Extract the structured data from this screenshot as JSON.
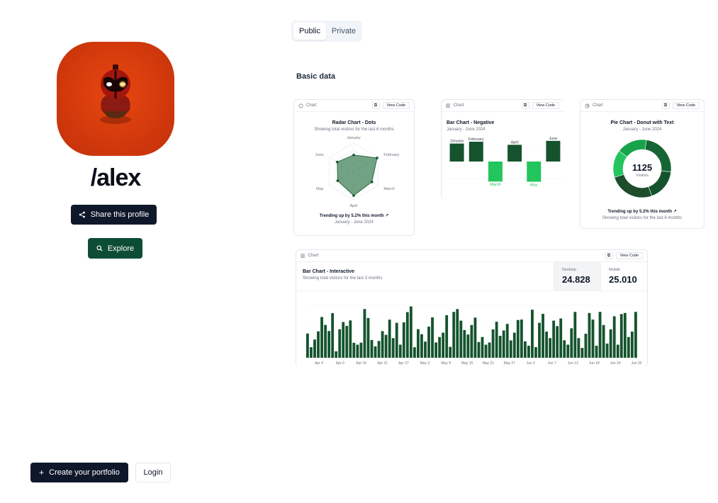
{
  "profile": {
    "username": "/alex",
    "share_label": "Share this profile",
    "explore_label": "Explore"
  },
  "footer": {
    "create_label": "Create your portfolio",
    "login_label": "Login"
  },
  "tabs": [
    {
      "label": "Public",
      "active": true
    },
    {
      "label": "Private",
      "active": false
    }
  ],
  "section_title": "Basic data",
  "card_common": {
    "chart_label": "Chart",
    "view_code_label": "View Code"
  },
  "colors": {
    "dark_green": "#14532d",
    "light_green": "#22c55e",
    "mid_green": "#166534",
    "navy": "#0f172a"
  },
  "chart_data": [
    {
      "type": "radar",
      "title": "Radar Chart - Dots",
      "subtitle": "Showing total visitors for the last 6 months",
      "categories": [
        "January",
        "February",
        "March",
        "April",
        "May",
        "June"
      ],
      "values": [
        186,
        305,
        237,
        273,
        209,
        214
      ],
      "footer_trend": "Trending up by 5.2% this month",
      "footer_range": "January - June 2024"
    },
    {
      "type": "bar",
      "title": "Bar Chart - Negative",
      "subtitle": "January - June 2024",
      "categories": [
        "January",
        "February",
        "March",
        "April",
        "May",
        "June"
      ],
      "values": [
        186,
        205,
        -207,
        173,
        -209,
        214
      ]
    },
    {
      "type": "pie",
      "title": "Pie Chart - Donut with Text",
      "subtitle": "January - June 2024",
      "center_value": "1125",
      "center_label": "Visitors",
      "values": [
        275,
        200,
        287,
        173,
        190
      ],
      "footer_trend": "Trending up by 5.2% this month",
      "footer_sub": "Showing total visitors for the last 6 months"
    },
    {
      "type": "bar",
      "title": "Bar Chart - Interactive",
      "subtitle": "Showing total visitors for the last 3 months",
      "stats": [
        {
          "label": "Desktop",
          "value": "24.828",
          "active": true
        },
        {
          "label": "Mobile",
          "value": "25.010",
          "active": false
        }
      ],
      "x_ticks": [
        "Apr 4",
        "Apr 9",
        "Apr 15",
        "Apr 21",
        "Apr 27",
        "May 3",
        "May 9",
        "May 15",
        "May 21",
        "May 27",
        "Jun 2",
        "Jun 7",
        "Jun 12",
        "Jun 18",
        "Jun 24",
        "Jun 30"
      ],
      "values": [
        222,
        97,
        167,
        242,
        373,
        301,
        245,
        409,
        59,
        261,
        327,
        292,
        342,
        137,
        120,
        138,
        446,
        364,
        163,
        105,
        154,
        244,
        210,
        349,
        180,
        320,
        120,
        324,
        418,
        470,
        96,
        262,
        216,
        148,
        285,
        370,
        140,
        190,
        230,
        390,
        100,
        420,
        446,
        340,
        254,
        213,
        300,
        368,
        144,
        190,
        120,
        140,
        260,
        330,
        201,
        250,
        310,
        159,
        230,
        346,
        350,
        150,
        110,
        440,
        97,
        320,
        402,
        240,
        180,
        340,
        290,
        360,
        160,
        120,
        270,
        420,
        180,
        90,
        220,
        410,
        350,
        110,
        420,
        300,
        130,
        260,
        380,
        120,
        400,
        410,
        190,
        240,
        420
      ]
    }
  ]
}
